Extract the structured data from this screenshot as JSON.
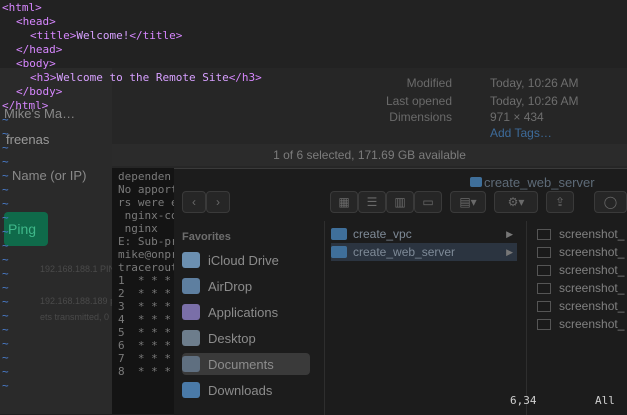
{
  "vim": {
    "lines": [
      {
        "indent": 0,
        "open": "<html>",
        "text": "",
        "close": ""
      },
      {
        "indent": 2,
        "open": "<head>",
        "text": "",
        "close": ""
      },
      {
        "indent": 4,
        "open": "<title>",
        "text": "Welcome!",
        "close": "</title>"
      },
      {
        "indent": 2,
        "open": "</head>",
        "text": "",
        "close": ""
      },
      {
        "indent": 2,
        "open": "<body>",
        "text": "",
        "close": ""
      },
      {
        "indent": 4,
        "open": "<h3>",
        "text": "Welcome to the Remote Site",
        "close": "</h3>"
      },
      {
        "indent": 2,
        "open": "</body>",
        "text": "",
        "close": ""
      },
      {
        "indent": 0,
        "open": "</html>",
        "text": "",
        "close": ""
      }
    ],
    "tilde": "~",
    "ruler": "6,34",
    "scroll": "All"
  },
  "info": {
    "modified_key": "Modified",
    "modified_val": "Today, 10:26 AM",
    "opened_key": "Last opened",
    "opened_val": "Today, 10:26 AM",
    "dimensions_key": "Dimensions",
    "dimensions_val": "971 × 434",
    "add_tags": "Add Tags…"
  },
  "status": "1 of 6 selected, 171.69 GB available",
  "ping_app": {
    "title": "Mike's Ma…",
    "host": "freenas",
    "field_label": "Name (or IP)",
    "ping_label": "Ping"
  },
  "terminal": {
    "lines": [
      "dependen",
      "No apport",
      "rs were e",
      " nginx-co",
      " nginx",
      "E: Sub-pr",
      "mike@onpr",
      "tracerout",
      "1  * * *",
      "2  * * *",
      "3  * * *",
      "4  * * *",
      "5  * * *",
      "6  * * *",
      "7  * * *",
      "8  * * *"
    ]
  },
  "finder": {
    "title": "create_web_server",
    "sidebar_header": "Favorites",
    "sidebar": [
      {
        "label": "iCloud Drive",
        "icon": "cloud-icon"
      },
      {
        "label": "AirDrop",
        "icon": "airdrop-icon"
      },
      {
        "label": "Applications",
        "icon": "applications-icon"
      },
      {
        "label": "Desktop",
        "icon": "desktop-icon"
      },
      {
        "label": "Documents",
        "icon": "documents-icon"
      },
      {
        "label": "Downloads",
        "icon": "downloads-icon"
      }
    ],
    "column1": [
      {
        "label": "create_vpc"
      },
      {
        "label": "create_web_server"
      }
    ],
    "column2": [
      "screenshot_",
      "screenshot_",
      "screenshot_",
      "screenshot_",
      "screenshot_",
      "screenshot_"
    ]
  }
}
